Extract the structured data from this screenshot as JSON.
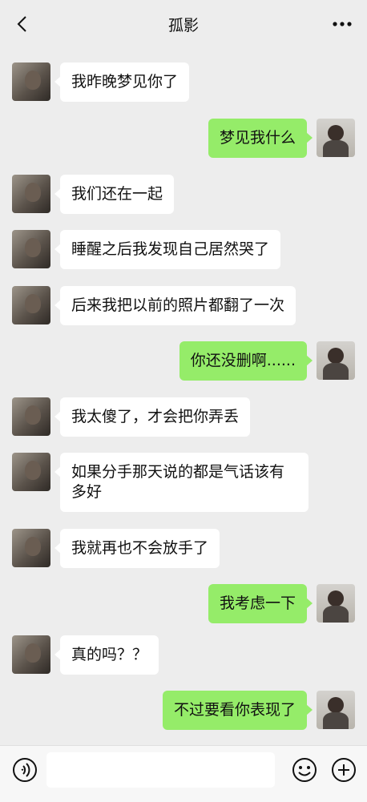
{
  "header": {
    "title": "孤影",
    "back_icon": "chevron-left-icon",
    "more_icon": "more-dots-icon"
  },
  "messages": [
    {
      "from": "contact",
      "text": "我昨晚梦见你了"
    },
    {
      "from": "me",
      "text": "梦见我什么"
    },
    {
      "from": "contact",
      "text": "我们还在一起"
    },
    {
      "from": "contact",
      "text": "睡醒之后我发现自己居然哭了"
    },
    {
      "from": "contact",
      "text": "后来我把以前的照片都翻了一次"
    },
    {
      "from": "me",
      "text": "你还没删啊......"
    },
    {
      "from": "contact",
      "text": "我太傻了，才会把你弄丢"
    },
    {
      "from": "contact",
      "text": "如果分手那天说的都是气话该有多好"
    },
    {
      "from": "contact",
      "text": "我就再也不会放手了"
    },
    {
      "from": "me",
      "text": "我考虑一下"
    },
    {
      "from": "contact",
      "text": "真的吗？？"
    },
    {
      "from": "me",
      "text": "不过要看你表现了"
    }
  ],
  "bottom_bar": {
    "voice_icon": "voice-icon",
    "input_value": "",
    "emoji_icon": "emoji-icon",
    "plus_icon": "plus-icon"
  },
  "colors": {
    "background": "#ededed",
    "sent_bubble": "#95ec69",
    "received_bubble": "#ffffff"
  }
}
